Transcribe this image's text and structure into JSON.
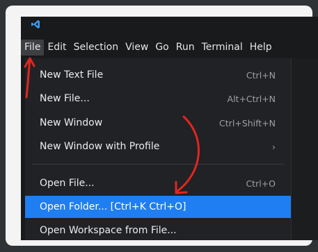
{
  "menubar": {
    "items": [
      "File",
      "Edit",
      "Selection",
      "View",
      "Go",
      "Run",
      "Terminal",
      "Help"
    ]
  },
  "file_menu": {
    "items": [
      {
        "label": "New Text File",
        "shortcut": "Ctrl+N"
      },
      {
        "label": "New File...",
        "shortcut": "Alt+Ctrl+N"
      },
      {
        "label": "New Window",
        "shortcut": "Ctrl+Shift+N"
      },
      {
        "label": "New Window with Profile",
        "shortcut": "›"
      },
      {
        "label": "Open File...",
        "shortcut": "Ctrl+O"
      },
      {
        "label": "Open Folder... [Ctrl+K Ctrl+O]",
        "shortcut": ""
      },
      {
        "label": "Open Workspace from File...",
        "shortcut": ""
      }
    ]
  },
  "colors": {
    "accent": "#1f7ef1",
    "annotation_arrow": "#e0261f",
    "logo": "#3b9bf0"
  },
  "icons": {
    "logo": "vscode-logo-icon",
    "submenu": "chevron-right-icon"
  }
}
